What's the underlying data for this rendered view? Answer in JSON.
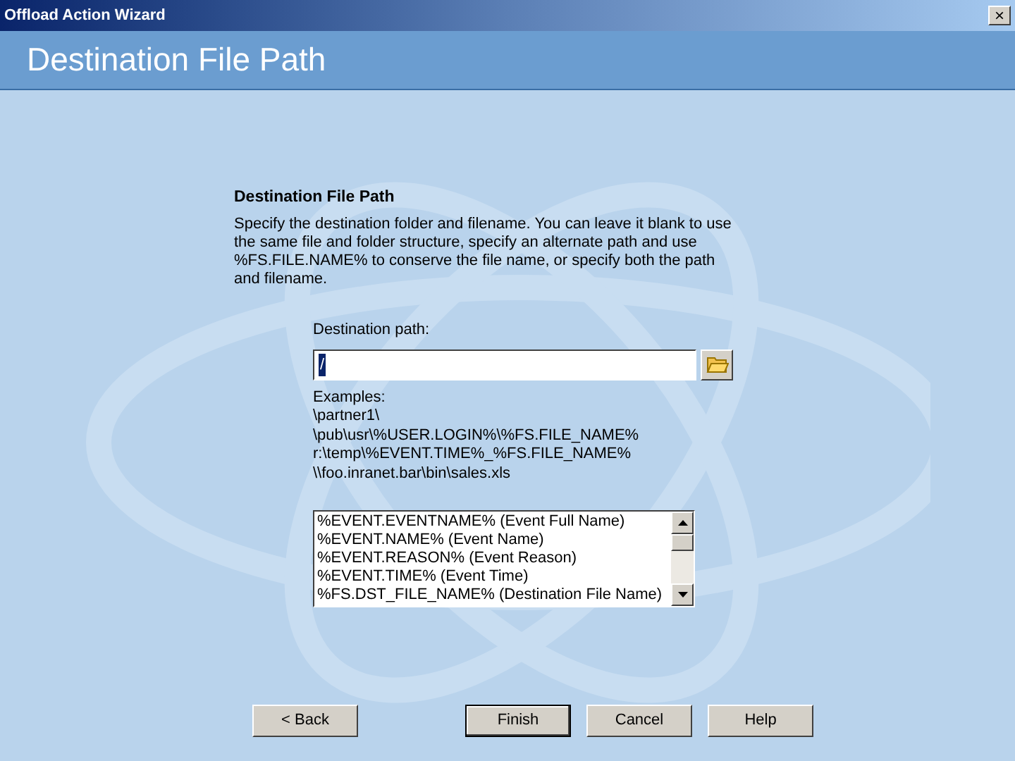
{
  "window": {
    "title": "Offload Action Wizard",
    "close": "×"
  },
  "header": {
    "title": "Destination File Path"
  },
  "section": {
    "heading": "Destination File Path",
    "description": "Specify the destination folder and filename. You can leave it blank to use the same file and folder structure, specify an alternate path and use %FS.FILE.NAME% to conserve the file name, or specify both the path and filename."
  },
  "destination": {
    "label": "Destination path:",
    "value": "/",
    "selected": true
  },
  "examples": [
    "Examples:",
    "\\partner1\\",
    "\\pub\\usr\\%USER.LOGIN%\\%FS.FILE_NAME%",
    "r:\\temp\\%EVENT.TIME%_%FS.FILE_NAME%",
    "\\\\foo.inranet.bar\\bin\\sales.xls"
  ],
  "variables": [
    "%EVENT.EVENTNAME% (Event Full Name)",
    "%EVENT.NAME% (Event Name)",
    "%EVENT.REASON% (Event Reason)",
    "%EVENT.TIME% (Event Time)",
    "%FS.DST_FILE_NAME% (Destination File Name)"
  ],
  "buttons": [
    {
      "label": "< Back",
      "default": false
    },
    {
      "label": "Finish",
      "default": true
    },
    {
      "label": "Cancel",
      "default": false
    },
    {
      "label": "Help",
      "default": false
    }
  ]
}
